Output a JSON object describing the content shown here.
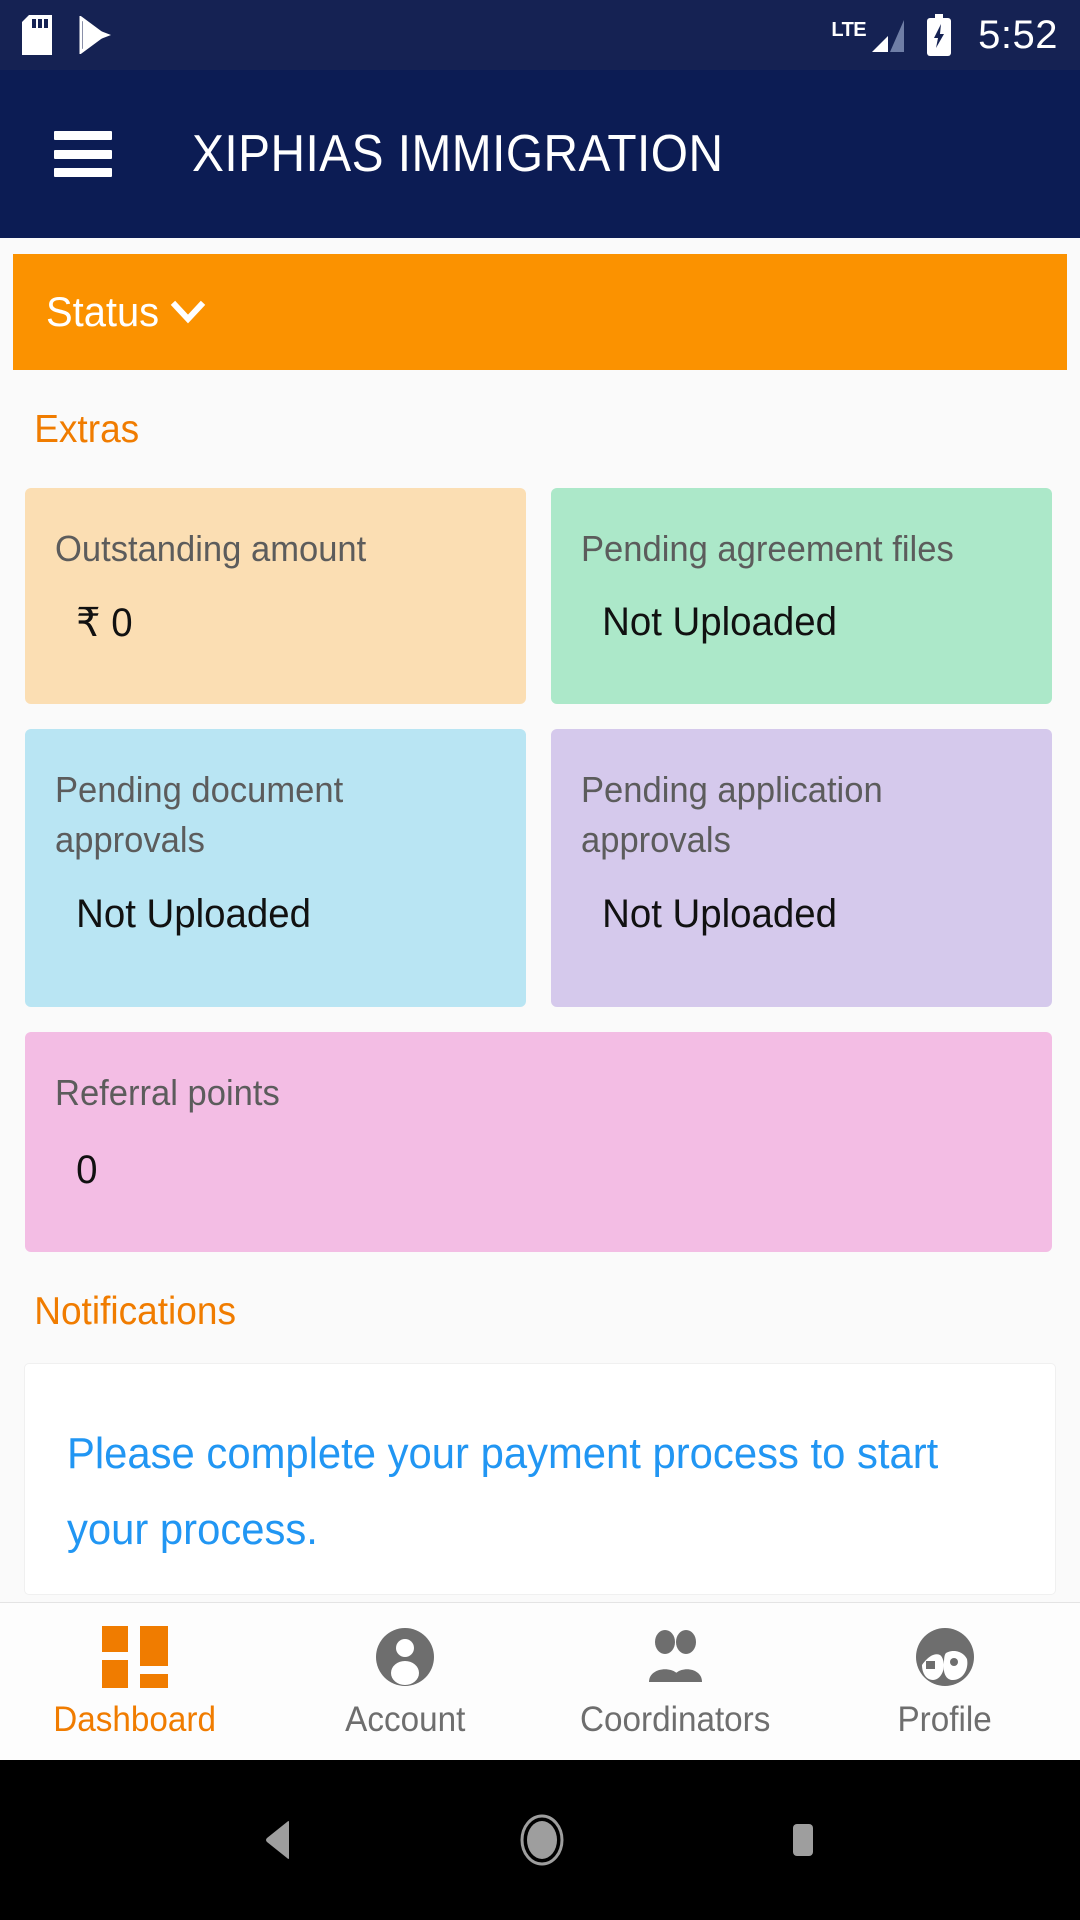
{
  "status_bar": {
    "left_icons": [
      "sd-card-icon",
      "play-store-icon"
    ],
    "network_label": "LTE",
    "right_icons": [
      "signal-bars-icon",
      "battery-charging-icon"
    ],
    "time": "5:52",
    "background_color": "#152253"
  },
  "app_bar": {
    "menu_icon": "hamburger-menu-icon",
    "title": "XIPHIAS IMMIGRATION",
    "background_color": "#0c1c54"
  },
  "status_accordion": {
    "label": "Status",
    "expand_icon": "chevron-down-icon",
    "background_color": "#fb9200",
    "expanded": false
  },
  "extras": {
    "heading": "Extras",
    "heading_color": "#f07c00",
    "cards": [
      {
        "title": "Outstanding amount",
        "value": "₹ 0",
        "color": "#fbdeb3",
        "span": "half"
      },
      {
        "title": "Pending agreement files",
        "value": "Not Uploaded",
        "color": "#ace8c9",
        "span": "half"
      },
      {
        "title": "Pending document approvals",
        "value": "Not Uploaded",
        "color": "#b9e5f3",
        "span": "half"
      },
      {
        "title": "Pending application approvals",
        "value": "Not Uploaded",
        "color": "#d5c9ec",
        "span": "half"
      },
      {
        "title": "Referral points",
        "value": "0",
        "color": "#f3bde4",
        "span": "full"
      }
    ]
  },
  "notifications": {
    "heading": "Notifications",
    "heading_color": "#f07c00",
    "items": [
      {
        "message": "Please complete your payment process to start your process.",
        "color": "#2196f3"
      }
    ]
  },
  "bottom_nav": {
    "active_color": "#f07c00",
    "inactive_color": "#6e6e6e",
    "items": [
      {
        "label": "Dashboard",
        "icon": "dashboard-grid-icon",
        "active": true
      },
      {
        "label": "Account",
        "icon": "account-person-icon",
        "active": false
      },
      {
        "label": "Coordinators",
        "icon": "people-group-icon",
        "active": false
      },
      {
        "label": "Profile",
        "icon": "profile-face-icon",
        "active": false
      }
    ]
  },
  "android_nav": {
    "back": "back-triangle-icon",
    "home": "home-circle-icon",
    "recents": "recents-square-icon"
  }
}
